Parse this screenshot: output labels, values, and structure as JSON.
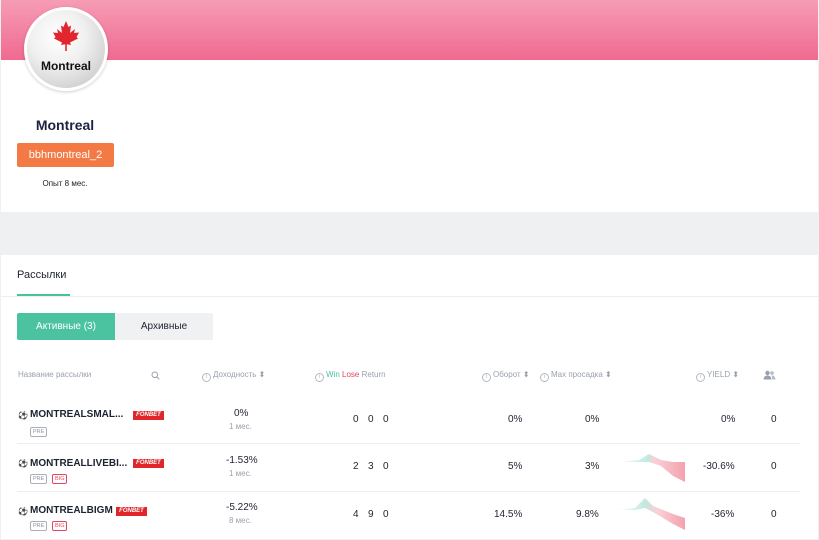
{
  "profile": {
    "logo_text": "Montreal",
    "name": "Montreal",
    "username": "bbhmontreal_2",
    "experience": "Опыт 8 мес."
  },
  "section": {
    "title": "Рассылки",
    "tab_active": "Активные (3)",
    "tab_archived": "Архивные"
  },
  "table": {
    "headers": {
      "name": "Название рассылки",
      "yield_period": "Доходность ⬍",
      "win": "Win",
      "lose": "Lose",
      "return": "Return",
      "turnover": "Оборот ⬍",
      "drawdown": "Max просадка ⬍",
      "yield": "YIELD ⬍"
    },
    "rows": [
      {
        "name": "MONTREALSMAL...",
        "bookmaker": "FONBET",
        "tag1": "PRE",
        "tag2": "",
        "profit": "0%",
        "period": "1 мес.",
        "win": "0",
        "lose": "0",
        "return": "0",
        "turnover": "0%",
        "drawdown": "0%",
        "yield": "0%",
        "subscribers": "0"
      },
      {
        "name": "MONTREALLIVEBI...",
        "bookmaker": "FONBET",
        "tag1": "PRE",
        "tag2": "BIG",
        "profit": "-1.53%",
        "period": "1 мес.",
        "win": "2",
        "lose": "3",
        "return": "0",
        "turnover": "5%",
        "drawdown": "3%",
        "yield": "-30.6%",
        "subscribers": "0"
      },
      {
        "name": "MONTREALBIGM",
        "bookmaker": "FONBET",
        "tag1": "PRE",
        "tag2": "BIG",
        "profit": "-5.22%",
        "period": "8 мес.",
        "win": "4",
        "lose": "9",
        "return": "0",
        "turnover": "14.5%",
        "drawdown": "9.8%",
        "yield": "-36%",
        "subscribers": "0"
      }
    ]
  },
  "colors": {
    "banner": "#f06a90",
    "username_badge": "#f47a45",
    "accent": "#4cc3a0",
    "lose": "#e8445e",
    "bookmaker": "#e0262b"
  },
  "icons": [
    "maple-leaf-logo",
    "search-icon",
    "info-icon",
    "users-icon",
    "soccer-ball-icon",
    "sparkline"
  ]
}
